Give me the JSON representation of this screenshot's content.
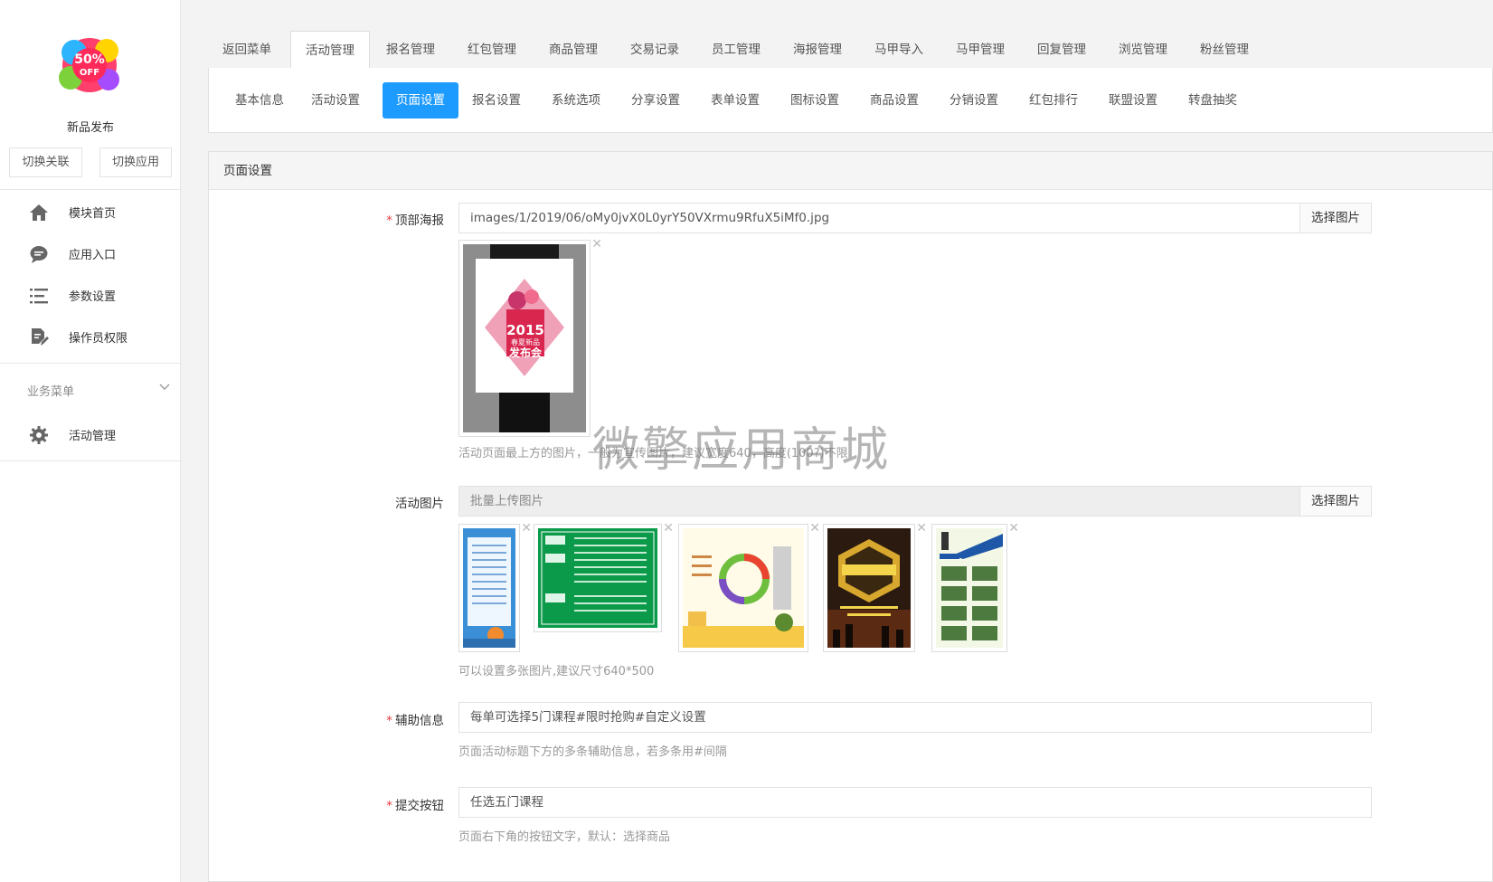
{
  "sidebar": {
    "app_name": "新品发布",
    "switch_link_label": "切换关联",
    "switch_app_label": "切换应用",
    "nav_items": [
      {
        "label": "模块首页",
        "icon": "home-icon"
      },
      {
        "label": "应用入口",
        "icon": "chat-bubble-icon"
      },
      {
        "label": "参数设置",
        "icon": "list-settings-icon"
      },
      {
        "label": "操作员权限",
        "icon": "edit-document-icon"
      }
    ],
    "business_menu_label": "业务菜单",
    "business_items": [
      {
        "label": "活动管理",
        "icon": "gear-icon"
      }
    ]
  },
  "tabs": [
    {
      "label": "返回菜单",
      "active": false
    },
    {
      "label": "活动管理",
      "active": true
    },
    {
      "label": "报名管理",
      "active": false
    },
    {
      "label": "红包管理",
      "active": false
    },
    {
      "label": "商品管理",
      "active": false
    },
    {
      "label": "交易记录",
      "active": false
    },
    {
      "label": "员工管理",
      "active": false
    },
    {
      "label": "海报管理",
      "active": false
    },
    {
      "label": "马甲导入",
      "active": false
    },
    {
      "label": "马甲管理",
      "active": false
    },
    {
      "label": "回复管理",
      "active": false
    },
    {
      "label": "浏览管理",
      "active": false
    },
    {
      "label": "粉丝管理",
      "active": false
    }
  ],
  "subtabs": [
    {
      "label": "基本信息",
      "active": false
    },
    {
      "label": "活动设置",
      "active": false
    },
    {
      "label": "页面设置",
      "active": true
    },
    {
      "label": "报名设置",
      "active": false
    },
    {
      "label": "系统选项",
      "active": false
    },
    {
      "label": "分享设置",
      "active": false
    },
    {
      "label": "表单设置",
      "active": false
    },
    {
      "label": "图标设置",
      "active": false
    },
    {
      "label": "商品设置",
      "active": false
    },
    {
      "label": "分销设置",
      "active": false
    },
    {
      "label": "红包排行",
      "active": false
    },
    {
      "label": "联盟设置",
      "active": false
    },
    {
      "label": "转盘抽奖",
      "active": false
    }
  ],
  "panel": {
    "title": "页面设置",
    "top_poster": {
      "label": "顶部海报",
      "required": true,
      "value": "images/1/2019/06/oMy0jvX0L0yrY50VXrmu9RfuX5iMf0.jpg",
      "pick_label": "选择图片",
      "help": "活动页面最上方的图片，一般为宣传图片，建议宽度640，高度(100?)不限",
      "poster_text": [
        "2015",
        "春夏新品",
        "发布会"
      ]
    },
    "activity_images": {
      "label": "活动图片",
      "placeholder": "批量上传图片",
      "pick_label": "选择图片",
      "help": "可以设置多张图片,建议尺寸640*500",
      "count": 5
    },
    "aux_info": {
      "label": "辅助信息",
      "required": true,
      "value": "每单可选择5门课程#限时抢购#自定义设置",
      "help": "页面活动标题下方的多条辅助信息，若多条用#间隔"
    },
    "submit_button": {
      "label": "提交按钮",
      "required": true,
      "value": "任选五门课程",
      "help": "页面右下角的按钮文字，默认：选择商品"
    }
  },
  "watermark": "微擎应用商城",
  "colors": {
    "accent": "#1e9bff",
    "required": "#e4393c"
  }
}
